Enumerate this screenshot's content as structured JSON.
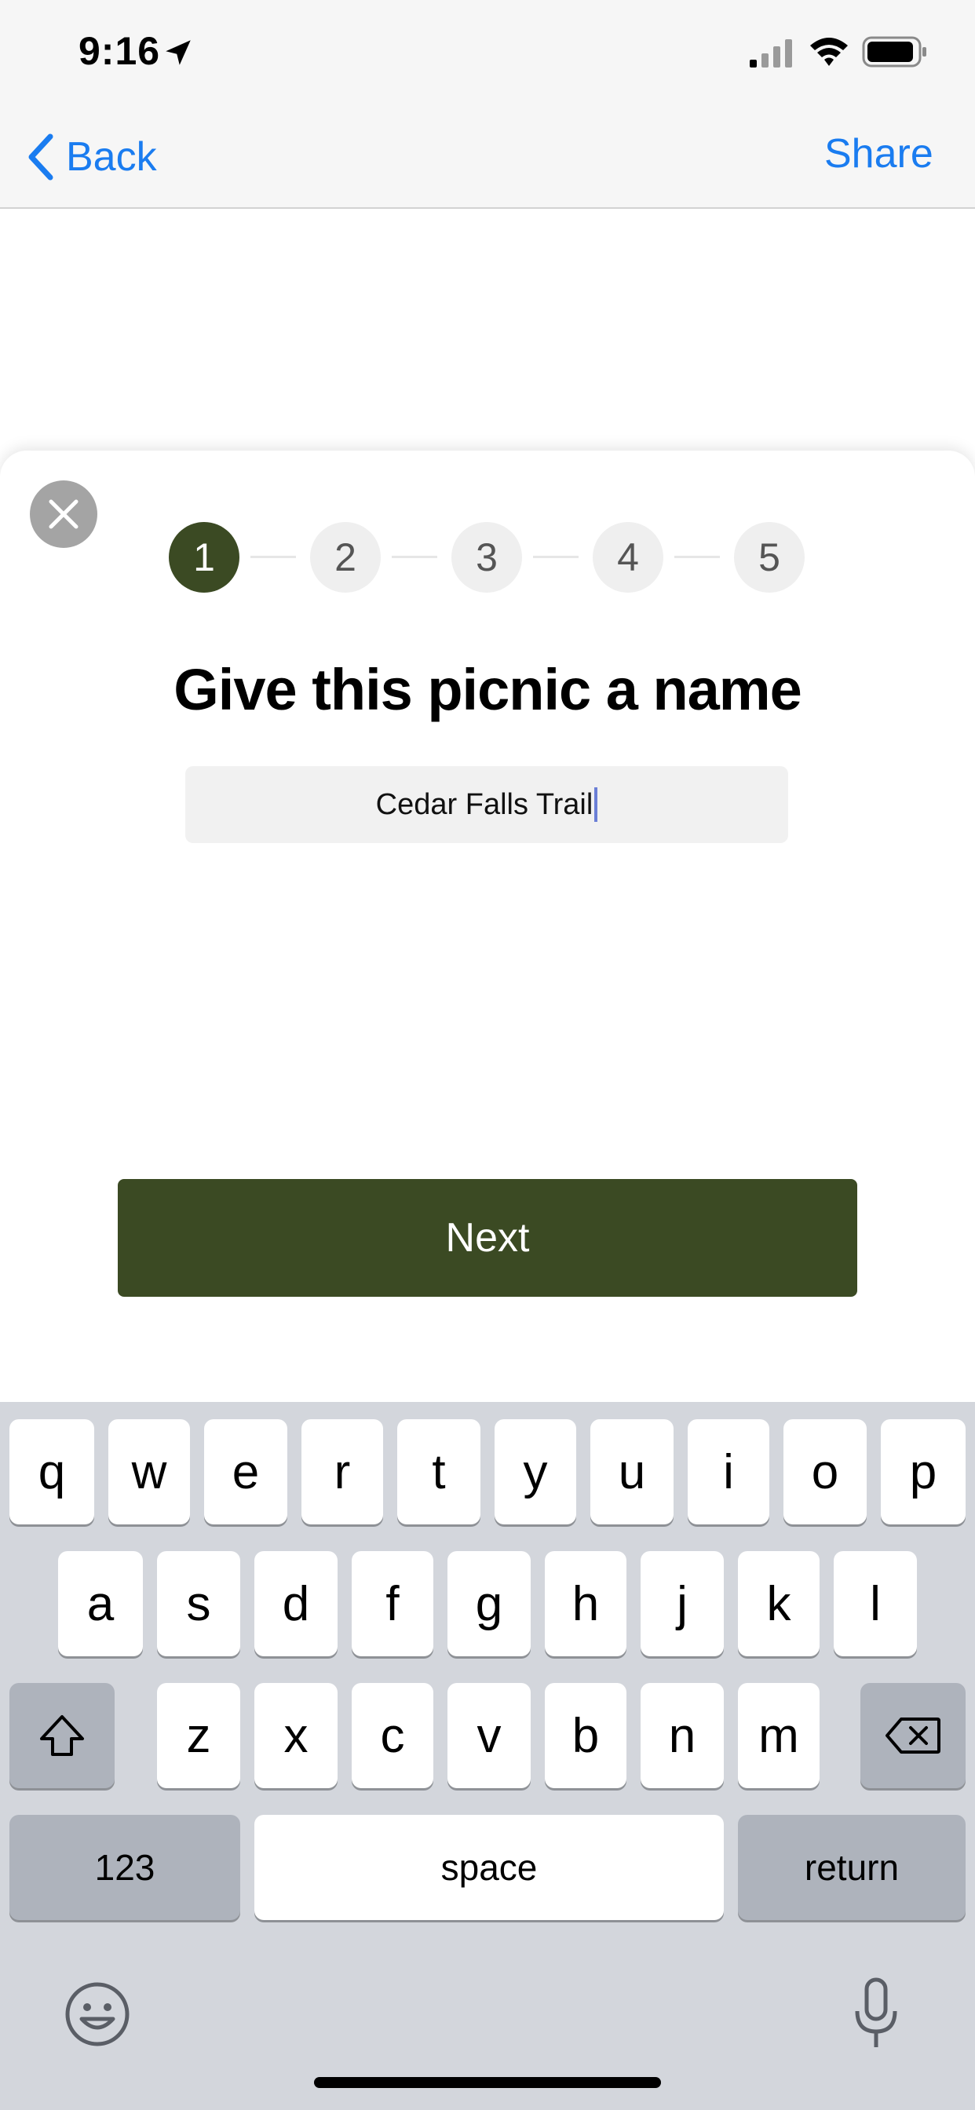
{
  "status_bar": {
    "time": "9:16",
    "icons": [
      "location-arrow-icon",
      "cellular-signal-icon",
      "wifi-icon",
      "battery-icon"
    ]
  },
  "nav": {
    "back_label": "Back",
    "share_label": "Share",
    "accent_color": "#1a7cf0"
  },
  "sheet": {
    "steps": [
      "1",
      "2",
      "3",
      "4",
      "5"
    ],
    "current_step": 1,
    "heading": "Give this picnic a name",
    "name_value": "Cedar Falls Trail",
    "next_label": "Next",
    "brand_color": "#3b4a23"
  },
  "keyboard": {
    "row1": [
      "q",
      "w",
      "e",
      "r",
      "t",
      "y",
      "u",
      "i",
      "o",
      "p"
    ],
    "row2": [
      "a",
      "s",
      "d",
      "f",
      "g",
      "h",
      "j",
      "k",
      "l"
    ],
    "row3": [
      "z",
      "x",
      "c",
      "v",
      "b",
      "n",
      "m"
    ],
    "numbers_label": "123",
    "space_label": "space",
    "return_label": "return"
  }
}
